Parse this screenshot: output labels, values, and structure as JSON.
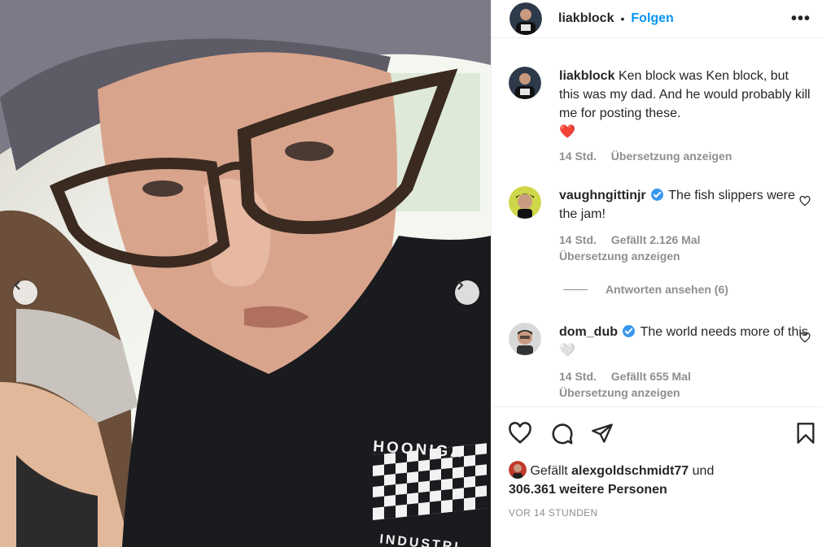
{
  "post": {
    "username": "liakblock",
    "separator": "•",
    "follow_label": "Folgen",
    "more_label": "•••"
  },
  "photo": {
    "shirt_text_top": "HOONIGA",
    "shirt_text_bottom": "INDUSTRI",
    "icons": {
      "prev": "chevron-left-icon",
      "next": "chevron-right-icon"
    }
  },
  "caption": {
    "username": "liakblock",
    "text": "Ken block was Ken block, but this was my dad. And he would probably kill me for posting these.",
    "emoji": "❤️",
    "time": "14 Std.",
    "translate": "Übersetzung anzeigen"
  },
  "comments": [
    {
      "username": "vaughngittinjr",
      "text": "The fish slippers were the jam!",
      "time": "14 Std.",
      "likes": "Gefällt 2.126 Mal",
      "translate": "Übersetzung anzeigen",
      "replies": "Antworten ansehen (6)"
    },
    {
      "username": "dom_dub",
      "text": "The world needs more of this",
      "emoji": "🤍",
      "time": "14 Std.",
      "likes": "Gefällt 655 Mal",
      "translate": "Übersetzung anzeigen"
    }
  ],
  "likes": {
    "prefix": "Gefällt",
    "user": "alexgoldschmidt77",
    "conj": "und",
    "others": "306.361 weitere Personen"
  },
  "timestamp": "VOR 14 STUNDEN",
  "colors": {
    "accent": "#0095f6",
    "verified": "#3897f0",
    "muted": "#8e8e8e",
    "heart": "#ed4956"
  }
}
